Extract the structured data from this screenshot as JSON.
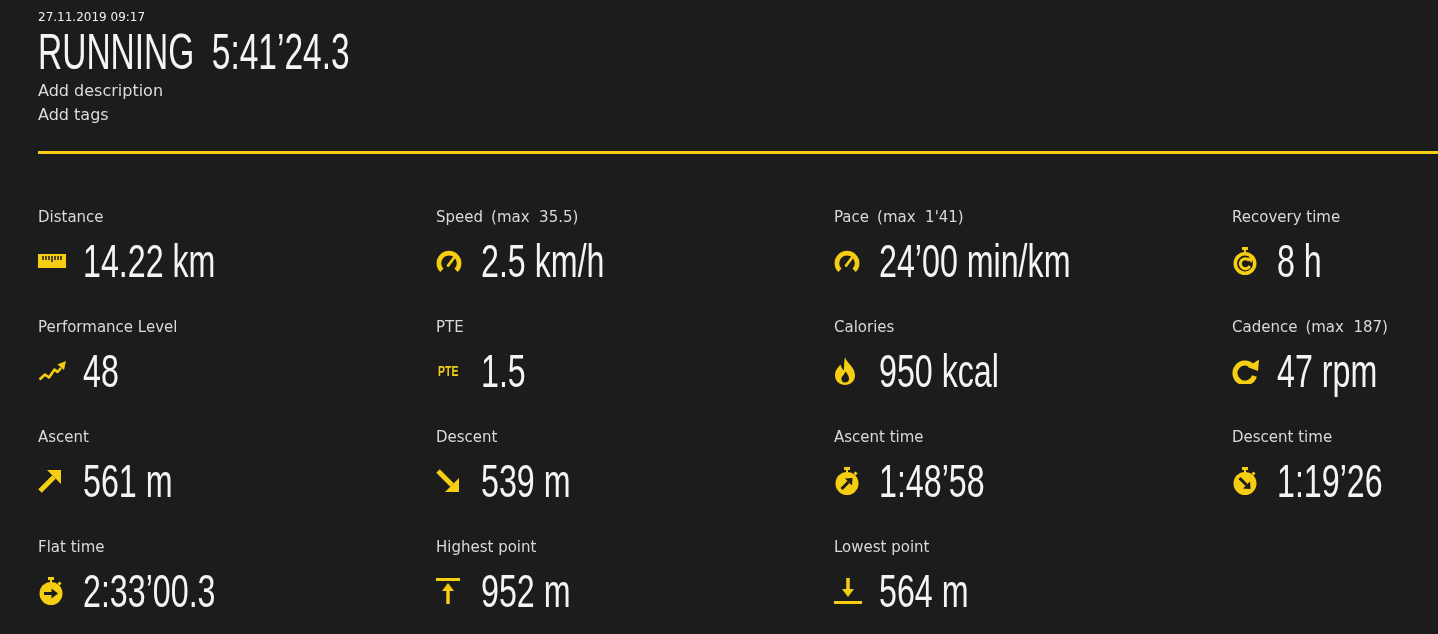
{
  "activity": {
    "date": "27.11.2019 09:17",
    "sport": "RUNNING",
    "duration": "5:41’24.3",
    "add_description": "Add description",
    "add_tags": "Add tags"
  },
  "stats": [
    {
      "kind": "distance",
      "label": "Distance",
      "value": "14.22 km"
    },
    {
      "kind": "speed",
      "label": "Speed",
      "max": "(max  35.5)",
      "value": "2.5 km/h"
    },
    {
      "kind": "pace",
      "label": "Pace",
      "max": "(max  1'41)",
      "value": "24’00 min/km"
    },
    {
      "kind": "recovery",
      "label": "Recovery time",
      "value": "8 h"
    },
    {
      "kind": "performance",
      "label": "Performance Level",
      "value": "48"
    },
    {
      "kind": "pte",
      "label": "PTE",
      "icon_text": "PTE",
      "value": "1.5"
    },
    {
      "kind": "calories",
      "label": "Calories",
      "value": "950 kcal"
    },
    {
      "kind": "cadence",
      "label": "Cadence",
      "max": "(max  187)",
      "value": "47 rpm"
    },
    {
      "kind": "ascent",
      "label": "Ascent",
      "value": "561 m"
    },
    {
      "kind": "descent",
      "label": "Descent",
      "value": "539 m"
    },
    {
      "kind": "ascenttime",
      "label": "Ascent time",
      "value": "1:48’58"
    },
    {
      "kind": "descenttime",
      "label": "Descent time",
      "value": "1:19’26"
    },
    {
      "kind": "flattime",
      "label": "Flat time",
      "value": "2:33’00.3"
    },
    {
      "kind": "highest",
      "label": "Highest point",
      "value": "952 m"
    },
    {
      "kind": "lowest",
      "label": "Lowest point",
      "value": "564 m"
    }
  ]
}
